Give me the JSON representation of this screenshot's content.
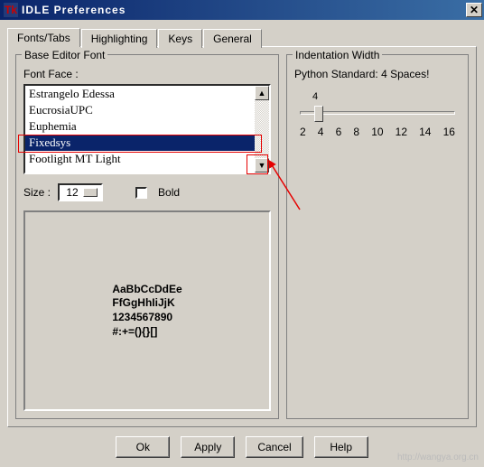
{
  "window": {
    "title": "IDLE Preferences",
    "icon_text": "Tk"
  },
  "tabs": [
    {
      "label": "Fonts/Tabs",
      "active": true
    },
    {
      "label": "Highlighting",
      "active": false
    },
    {
      "label": "Keys",
      "active": false
    },
    {
      "label": "General",
      "active": false
    }
  ],
  "font_group": {
    "legend": "Base Editor Font",
    "face_label": "Font Face :",
    "items": [
      "Estrangelo Edessa",
      "EucrosiaUPC",
      "Euphemia",
      "Fixedsys",
      "Footlight MT Light"
    ],
    "selected": "Fixedsys",
    "size_label": "Size :",
    "size_value": "12",
    "bold_label": "Bold",
    "bold_checked": false,
    "preview_lines": [
      "AaBbCcDdEe",
      "FfGgHhIiJjK",
      "1234567890",
      "#:+=(){}[]"
    ]
  },
  "indent_group": {
    "legend": "Indentation Width",
    "standard_label": "Python Standard: 4 Spaces!",
    "current_value": "4",
    "ticks": [
      "2",
      "4",
      "6",
      "8",
      "10",
      "12",
      "14",
      "16"
    ]
  },
  "buttons": {
    "ok": "Ok",
    "apply": "Apply",
    "cancel": "Cancel",
    "help": "Help"
  },
  "watermark": "http://wangya.org.cn"
}
